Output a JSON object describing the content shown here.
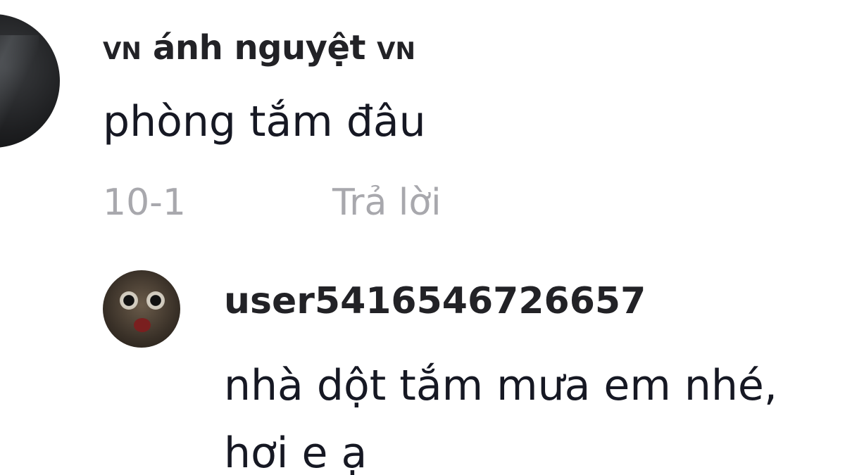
{
  "comment": {
    "flag_left": "VN",
    "username": "ánh nguyệt",
    "flag_right": "VN",
    "text": "phòng tắm đâu",
    "date": "10-1",
    "reply_label": "Trả lời"
  },
  "reply": {
    "username": "user5416546726657",
    "text_line1": "nhà dột tắm mưa em nhé,",
    "text_line2": "hơi e ạ"
  }
}
